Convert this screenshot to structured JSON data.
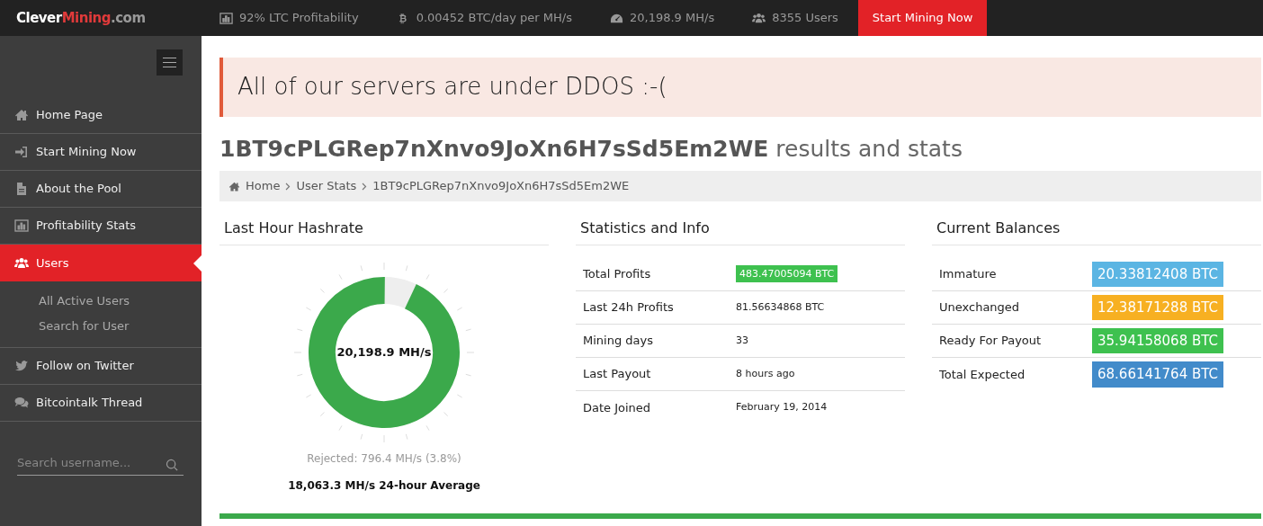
{
  "brand": {
    "part_1": "Clever",
    "part_2": "Mining",
    "part_3": ".com"
  },
  "top_stats": [
    {
      "text": "92% LTC Profitability"
    },
    {
      "text": "0.00452 BTC/day per MH/s"
    },
    {
      "text": "20,198.9 MH/s"
    },
    {
      "text": "8355 Users"
    }
  ],
  "top_button": "Start Mining Now",
  "sidebar": {
    "items": [
      {
        "label": "Home Page",
        "selected": false
      },
      {
        "label": "Start Mining Now",
        "selected": false
      },
      {
        "label": "About the Pool",
        "selected": false
      },
      {
        "label": "Profitability Stats",
        "selected": false
      },
      {
        "label": "Users",
        "selected": true,
        "children": [
          {
            "label": "All Active Users"
          },
          {
            "label": "Search for User"
          }
        ]
      },
      {
        "label": "Follow on Twitter",
        "selected": false
      },
      {
        "label": "Bitcointalk Thread",
        "selected": false
      }
    ],
    "search": {
      "placeholder": "Search username..."
    }
  },
  "alert": "All of our servers are under DDOS :-(",
  "heading": {
    "address": "1BT9cPLGRep7nXnvo9JoXn6H7sSd5Em2WE",
    "suffix": "results and stats"
  },
  "breadcrumb": [
    "Home",
    "User Stats",
    "1BT9cPLGRep7nXnvo9JoXn6H7sSd5Em2WE"
  ],
  "hashrate": {
    "title": "Last Hour Hashrate",
    "gauge": {
      "level": 0.93,
      "reading": "20,198.9 MH/s"
    },
    "rejected": "Rejected: 796.4 MH/s (3.8%)",
    "average": "18,063.3 MH/s 24-hour Average"
  },
  "stats": {
    "title": "Statistics and Info",
    "rows": [
      {
        "label": "Total Profits",
        "value": "483.47005094 BTC",
        "highlight": true
      },
      {
        "label": "Last 24h Profits",
        "value": "81.56634868 BTC",
        "highlight": false
      },
      {
        "label": "Mining days",
        "value": "33",
        "highlight": false
      },
      {
        "label": "Last Payout",
        "value": "8 hours ago",
        "highlight": false
      },
      {
        "label": "Date Joined",
        "value": "February 19, 2014",
        "highlight": false
      }
    ]
  },
  "balances": {
    "title": "Current Balances",
    "rows": [
      {
        "label": "Immature",
        "value": "20.33812408 BTC",
        "color": "#5bb5e3"
      },
      {
        "label": "Unexchanged",
        "value": "12.38171288 BTC",
        "color": "#f7b022"
      },
      {
        "label": "Ready For Payout",
        "value": "35.94158068 BTC",
        "color": "#3ec14f"
      },
      {
        "label": "Total Expected",
        "value": "68.66141764 BTC",
        "color": "#428bca"
      }
    ]
  }
}
